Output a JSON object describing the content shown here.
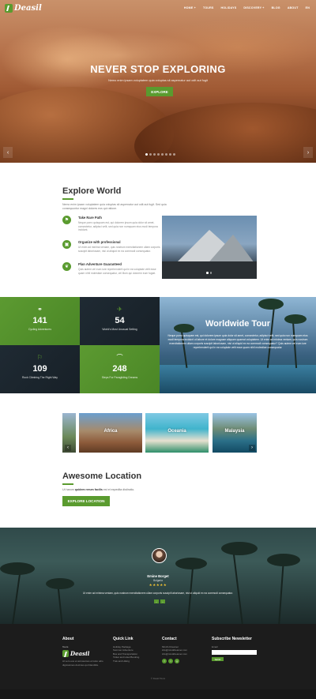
{
  "brand": {
    "name": "Deasil",
    "accent": "#5a9b2f"
  },
  "nav": {
    "items": [
      "HOME +",
      "TOURS",
      "HOLIDAYS",
      "DISCOVERY +",
      "BLOG",
      "ABOUT",
      "EN"
    ]
  },
  "hero": {
    "title": "NEVER STOP EXPLORING",
    "subtitle": "Nemo enim ipsam voluptatem quia voluptas sit aspernatur aut odit aut fugit",
    "button": "EXPLORE",
    "prev": "‹",
    "next": "›"
  },
  "explore": {
    "title": "Explore World",
    "intro": "Nemo enim ipsam voluptatem quia voluptas sit aspernatur aut odit aut fugit. Sed quia consequuntur magni dolores eos qui ratione.",
    "features": [
      {
        "icon": "signpost-icon",
        "glyph": "⚑",
        "title": "Take Rare Path",
        "desc": "Neque porro quisquam est, qui dolorem ipsum quia dolor sit amet, consectetur, adipisci velit, sed quia non numquam eius modi tempora incidunt."
      },
      {
        "icon": "bus-icon",
        "glyph": "▣",
        "title": "Organize with professional",
        "desc": "Ut enim ad minima veniam, quis nostrum exercitationem ullam corporis suscipit laboriosam, nisi ut aliquid ex ea commodi consequatur."
      },
      {
        "icon": "leaf-icon",
        "glyph": "❦",
        "title": "Plan Adventure Guaranteed",
        "desc": "Quis autem vel eum iure reprehenderit qui in ea voluptate velit esse quam nihil molestiae consequatur, vel illum qui dolorem eum fugiat."
      }
    ]
  },
  "stats": [
    {
      "icon": "bicycle-icon",
      "glyph": "⚭",
      "number": "141",
      "label": "Cycling Adventures"
    },
    {
      "icon": "airplane-icon",
      "glyph": "✈",
      "number": "54",
      "label": "World's Most Unusual Setting"
    },
    {
      "icon": "runner-icon",
      "glyph": "⚐",
      "number": "109",
      "label": "Rock Climbing The Right Way"
    },
    {
      "icon": "paraglider-icon",
      "glyph": "⌒",
      "number": "248",
      "label": "Steps For Paragliding Dreams"
    }
  ],
  "tour": {
    "title": "Worldwide Tour",
    "text": "Neque porro quisquam est, qui dolorem ipsum quia dolor sit amet, consectetur, adipisci velit, sed quia non numquam eius modi tempora incidunt ut labore et dolore magnam aliquam quaerat voluptatem. Ut enim ad minima veniam, quis nostrum exercitationem ullam corporis suscipit laboriosam, nisi ut aliquid ex ea commodi consequatur? Quis autem vel eum iure reprehenderit qui in ea voluptate velit esse quam nihil molestiae consequatur."
  },
  "destinations": [
    "",
    "Africa",
    "Oceania",
    "Malaysia"
  ],
  "awesome": {
    "title": "Awesome Location",
    "text_pre": "Ut harum ",
    "text_bold": "quidem rerum facilis",
    "text_post": " est et expedita distinctio.",
    "button": "EXPLORE LOCATION"
  },
  "testimonial": {
    "name": "Emine Borget",
    "role": "Bulgaria",
    "stars": "★★★★★",
    "quote": "Ut enim ad minima veniam, quis nostrum exercitationem ullam corporis suscipit laboriosam, nisi ut aliquid ex ea commodi consequatur."
  },
  "footer": {
    "about": {
      "title": "About",
      "brand_small": "Tours",
      "text": [
        "At vero eos et accusamus et iusto odio",
        "dignissimos ducimus qui blanditiis."
      ]
    },
    "quick": {
      "title": "Quick Link",
      "links": [
        "Holiday Package",
        "Summer Adventure",
        "Bus and Transportation",
        "Ticket and Hotel Booking",
        "Trek and Hiking"
      ]
    },
    "contact": {
      "title": "Contact",
      "lines": [
        "Mind's Dreamer",
        "info@minddreamer.com",
        "info@minddreamer.com"
      ]
    },
    "newsletter": {
      "title": "Subscribe Newsletter",
      "label": "Email",
      "button": "SEND"
    },
    "copyright": "© Deasil Tours"
  }
}
